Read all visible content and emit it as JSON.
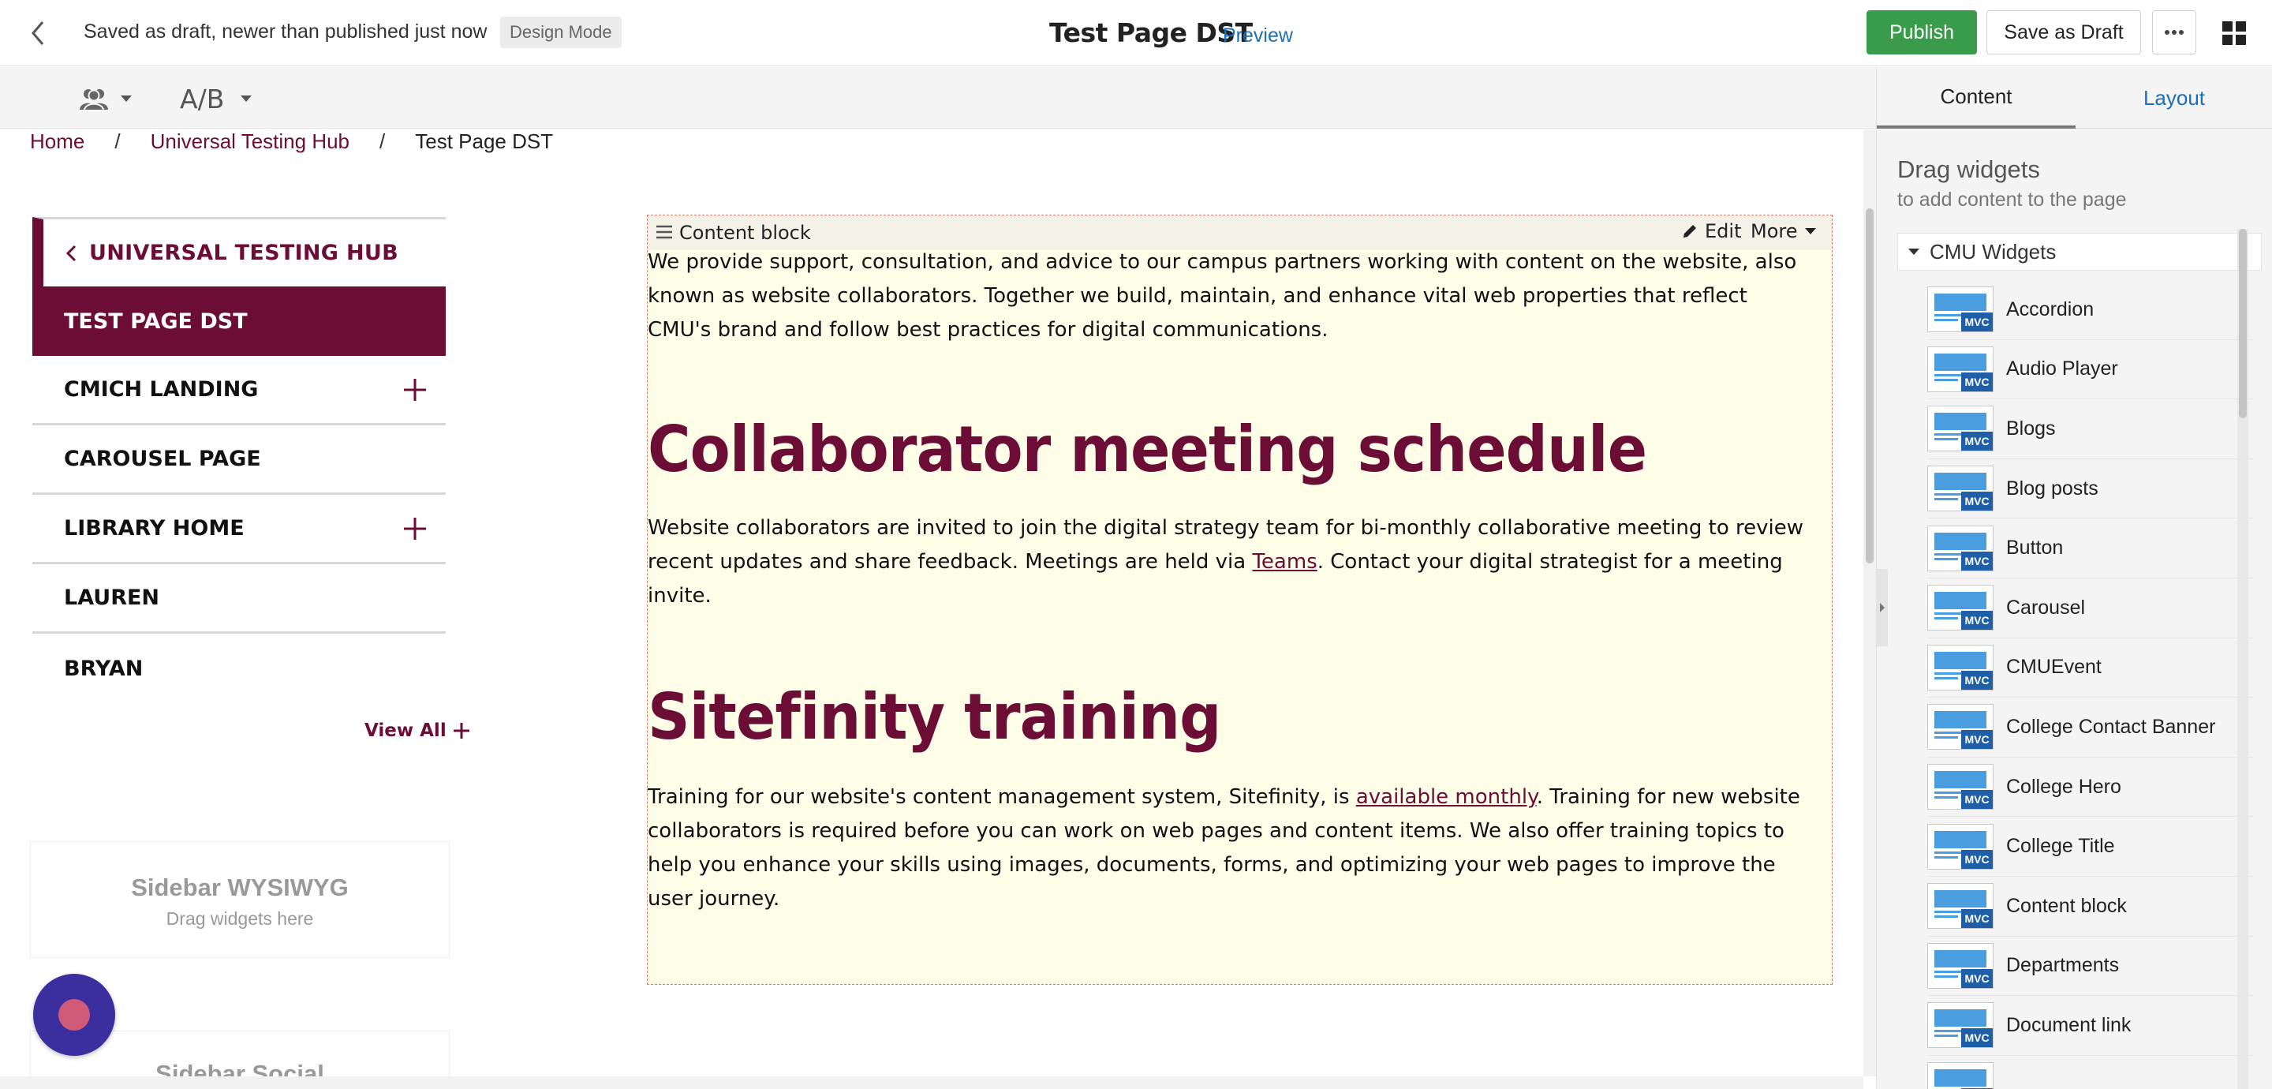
{
  "topbar": {
    "status": "Saved as draft, newer than published just now",
    "design_mode": "Design Mode",
    "page_title": "Test Page DST",
    "preview": "Preview",
    "publish": "Publish",
    "save_draft": "Save as Draft"
  },
  "toolbar": {
    "ab_label": "A/B"
  },
  "breadcrumb": {
    "home": "Home",
    "parent": "Universal Testing Hub",
    "current": "Test Page DST",
    "separator": "/"
  },
  "side_nav": {
    "parent": "UNIVERSAL TESTING HUB",
    "active": "TEST PAGE DST",
    "items": [
      {
        "label": "CMICH LANDING",
        "expandable": true
      },
      {
        "label": "CAROUSEL PAGE",
        "expandable": false
      },
      {
        "label": "LIBRARY HOME",
        "expandable": true
      },
      {
        "label": "LAUREN",
        "expandable": false
      },
      {
        "label": "BRYAN",
        "expandable": false
      }
    ],
    "view_all": "View All"
  },
  "sidebar_zone": {
    "title": "Sidebar WYSIWYG",
    "subtitle": "Drag widgets here",
    "title2": "Sidebar Social"
  },
  "content_block": {
    "header": "Content block",
    "edit": "Edit",
    "more": "More",
    "intro": "We provide support, consultation, and advice to our campus partners working with content on the website, also known as website collaborators. Together we build, maintain, and enhance vital web properties that reflect CMU's brand and follow best practices for digital communications.",
    "heading1": "Collaborator meeting schedule",
    "para1_before": "Website collaborators are invited to join the digital strategy team for bi-monthly collaborative meeting to review recent updates and share feedback. Meetings are held via ",
    "para1_link": "Teams",
    "para1_after": ". Contact your digital strategist for a meeting invite.",
    "heading2": "Sitefinity training",
    "para2_before": "Training for our website's content management system, Sitefinity, is ",
    "para2_link": "available monthly",
    "para2_after": ". Training for new website collaborators is required before you can work on web pages and content items. We also offer training topics to help you enhance your skills using images, documents, forms, and optimizing your web pages to improve the user journey."
  },
  "right_panel": {
    "tab_content": "Content",
    "tab_layout": "Layout",
    "title": "Drag widgets",
    "subtitle": "to add content to the page",
    "group": "CMU Widgets",
    "mvc_badge": "MVC",
    "widgets": [
      "Accordion",
      "Audio Player",
      "Blogs",
      "Blog posts",
      "Button",
      "Carousel",
      "CMUEvent",
      "College Contact Banner",
      "College Hero",
      "College Title",
      "Content block",
      "Departments",
      "Document link",
      ""
    ]
  },
  "colors": {
    "brand_maroon": "#6c0d35",
    "publish_green": "#3a9b4a",
    "link_blue": "#1a6fb8",
    "mvc_blue": "#1f5fa8",
    "content_block_bg": "#fefde8"
  }
}
